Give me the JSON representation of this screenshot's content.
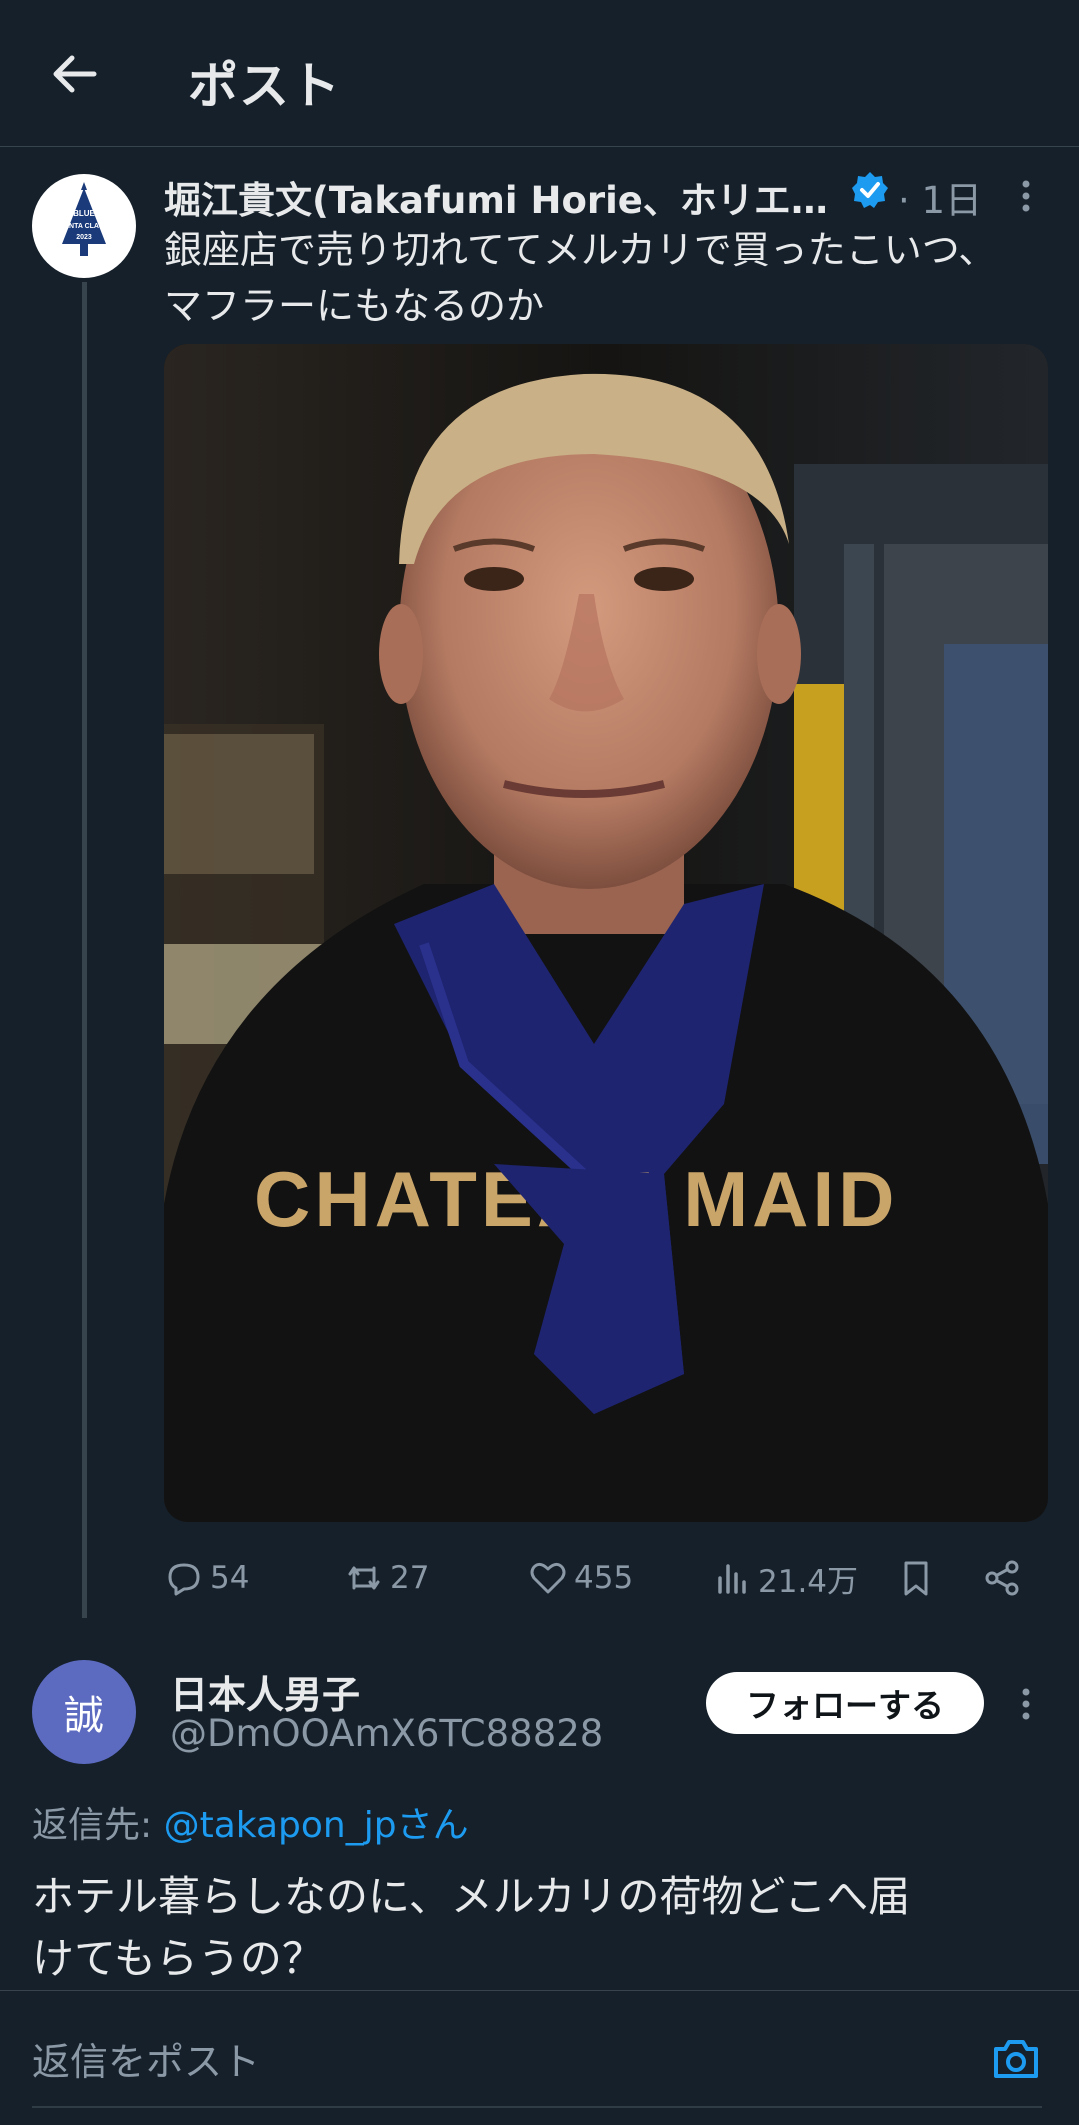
{
  "header": {
    "title": "ポスト"
  },
  "tweet": {
    "author_name": "堀江貴文(Takafumi Horie、ホリエ…",
    "time": "· 1日",
    "text_lines": [
      "銀座店で売り切れててメルカリで買ったこいつ、",
      "マフラーにもなるのか"
    ],
    "avatar_text": [
      "BLUE",
      "SANTA CLAUS",
      "2023"
    ],
    "shirt_text": "CHATEAU MAID",
    "stats": {
      "replies": "54",
      "retweets": "27",
      "likes": "455",
      "views": "21.4万"
    }
  },
  "reply": {
    "avatar_char": "誠",
    "name": "日本人男子",
    "handle": "@DmOOAmX6TC88828",
    "follow_label": "フォローする",
    "reply_to_label": "返信先:",
    "reply_to_mention": "@takapon_jpさん",
    "text_lines": [
      "ホテル暮らしなのに、メルカリの荷物どこへ届",
      "けてもらうの？"
    ]
  },
  "composer": {
    "placeholder": "返信をポスト"
  },
  "colors": {
    "background": "#15202b",
    "accent": "#1d9bf0",
    "muted": "#8b98a5",
    "avatar2": "#5c6bc0"
  }
}
